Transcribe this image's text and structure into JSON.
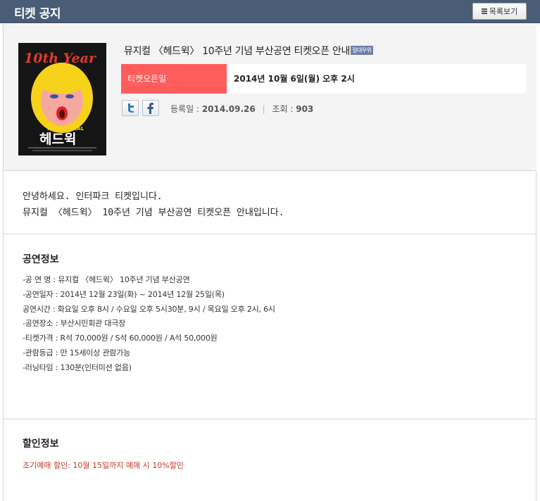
{
  "header": {
    "title": "티켓 공지",
    "list_button": "목록보기"
  },
  "notice": {
    "title": "뮤지컬 〈헤드윅〉 10주년 기념 부산공연 티켓오픈 안내",
    "rank_badge": "절대우위",
    "open_label": "티켓오픈일",
    "open_value": "2014년 10월 6일(월) 오후 2시",
    "register_label": "등록일 :",
    "register_value": "2014.09.26",
    "views_label": "조회 :",
    "views_value": "903"
  },
  "poster": {
    "top_text": "10th Year",
    "sub_text": "THE MUSICAL",
    "name_text": "헤드윅",
    "colors": {
      "bg": "#151515",
      "yellow": "#f7d21a",
      "red": "#d8262c"
    }
  },
  "greeting": {
    "line1": "안녕하세요. 인터파크 티켓입니다.",
    "line2": "뮤지컬 〈헤드윅〉 10주년 기념 부산공연 티켓오픈 안내입니다."
  },
  "performance": {
    "title": "공연정보",
    "items": [
      "-공 연 명 : 뮤지컬 〈헤드윅〉 10주년 기념 부산공연",
      "-공연일자 : 2014년 12월 23일(화) ~ 2014년 12월 25일(목)",
      "공연시간 : 화요일 오후 8시 / 수요일 오후 5시30분, 9시 / 목요일 오후 2시, 6시",
      "-공연장소 : 부산시민회관 대극장",
      "-티켓가격 : R석 70,000원 / S석 60,000원 / A석 50,000원",
      "-관람등급 : 만 15세이상 관람가능",
      "-러닝타임 : 130분(인터미션 없음)"
    ]
  },
  "discount": {
    "title": "할인정보",
    "text": "조기예매 할인: 10월 15일까지 예매 시 10%할인"
  },
  "colors": {
    "header_bg": "#4a5d76",
    "open_label_bg": "#ff5c5c",
    "discount_text": "#c0392b"
  }
}
